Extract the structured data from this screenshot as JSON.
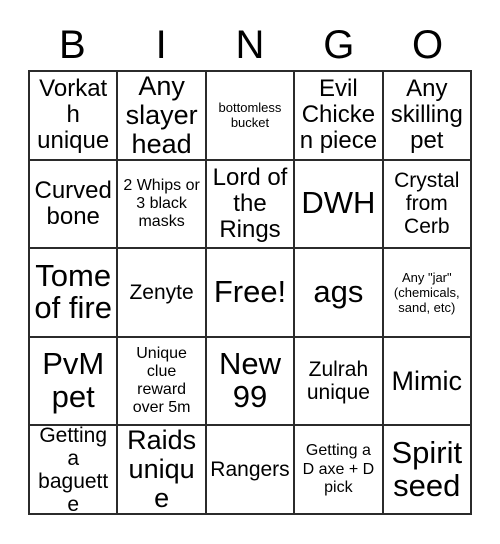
{
  "header": {
    "letters": [
      "B",
      "I",
      "N",
      "G",
      "O"
    ]
  },
  "grid": {
    "columns": 5,
    "rows": 5,
    "cells": [
      {
        "text": "Vorkath unique",
        "size": "lg"
      },
      {
        "text": "Any slayer head",
        "size": "xl"
      },
      {
        "text": "bottomless bucket",
        "size": "xs"
      },
      {
        "text": "Evil Chicken piece",
        "size": "lg"
      },
      {
        "text": "Any skilling pet",
        "size": "lg"
      },
      {
        "text": "Curved bone",
        "size": "lg"
      },
      {
        "text": "2 Whips or 3 black masks",
        "size": "sm"
      },
      {
        "text": "Lord of the Rings",
        "size": "lg"
      },
      {
        "text": "DWH",
        "size": "xxl"
      },
      {
        "text": "Crystal from Cerb",
        "size": "md"
      },
      {
        "text": "Tome of fire",
        "size": "xxl"
      },
      {
        "text": "Zenyte",
        "size": "md"
      },
      {
        "text": "Free!",
        "size": "xxl"
      },
      {
        "text": "ags",
        "size": "xxl"
      },
      {
        "text": "Any \"jar\" (chemicals, sand, etc)",
        "size": "xs"
      },
      {
        "text": "PvM pet",
        "size": "xxl"
      },
      {
        "text": "Unique clue reward over 5m",
        "size": "sm"
      },
      {
        "text": "New 99",
        "size": "xxl"
      },
      {
        "text": "Zulrah unique",
        "size": "md"
      },
      {
        "text": "Mimic",
        "size": "xl"
      },
      {
        "text": "Getting a baguette",
        "size": "md"
      },
      {
        "text": "Raids unique",
        "size": "xl"
      },
      {
        "text": "Rangers",
        "size": "md"
      },
      {
        "text": "Getting a D axe + D pick",
        "size": "sm"
      },
      {
        "text": "Spirit seed",
        "size": "xxl"
      }
    ]
  },
  "colors": {
    "text": "#000000",
    "border": "#2b2b2b",
    "background": "#ffffff"
  }
}
